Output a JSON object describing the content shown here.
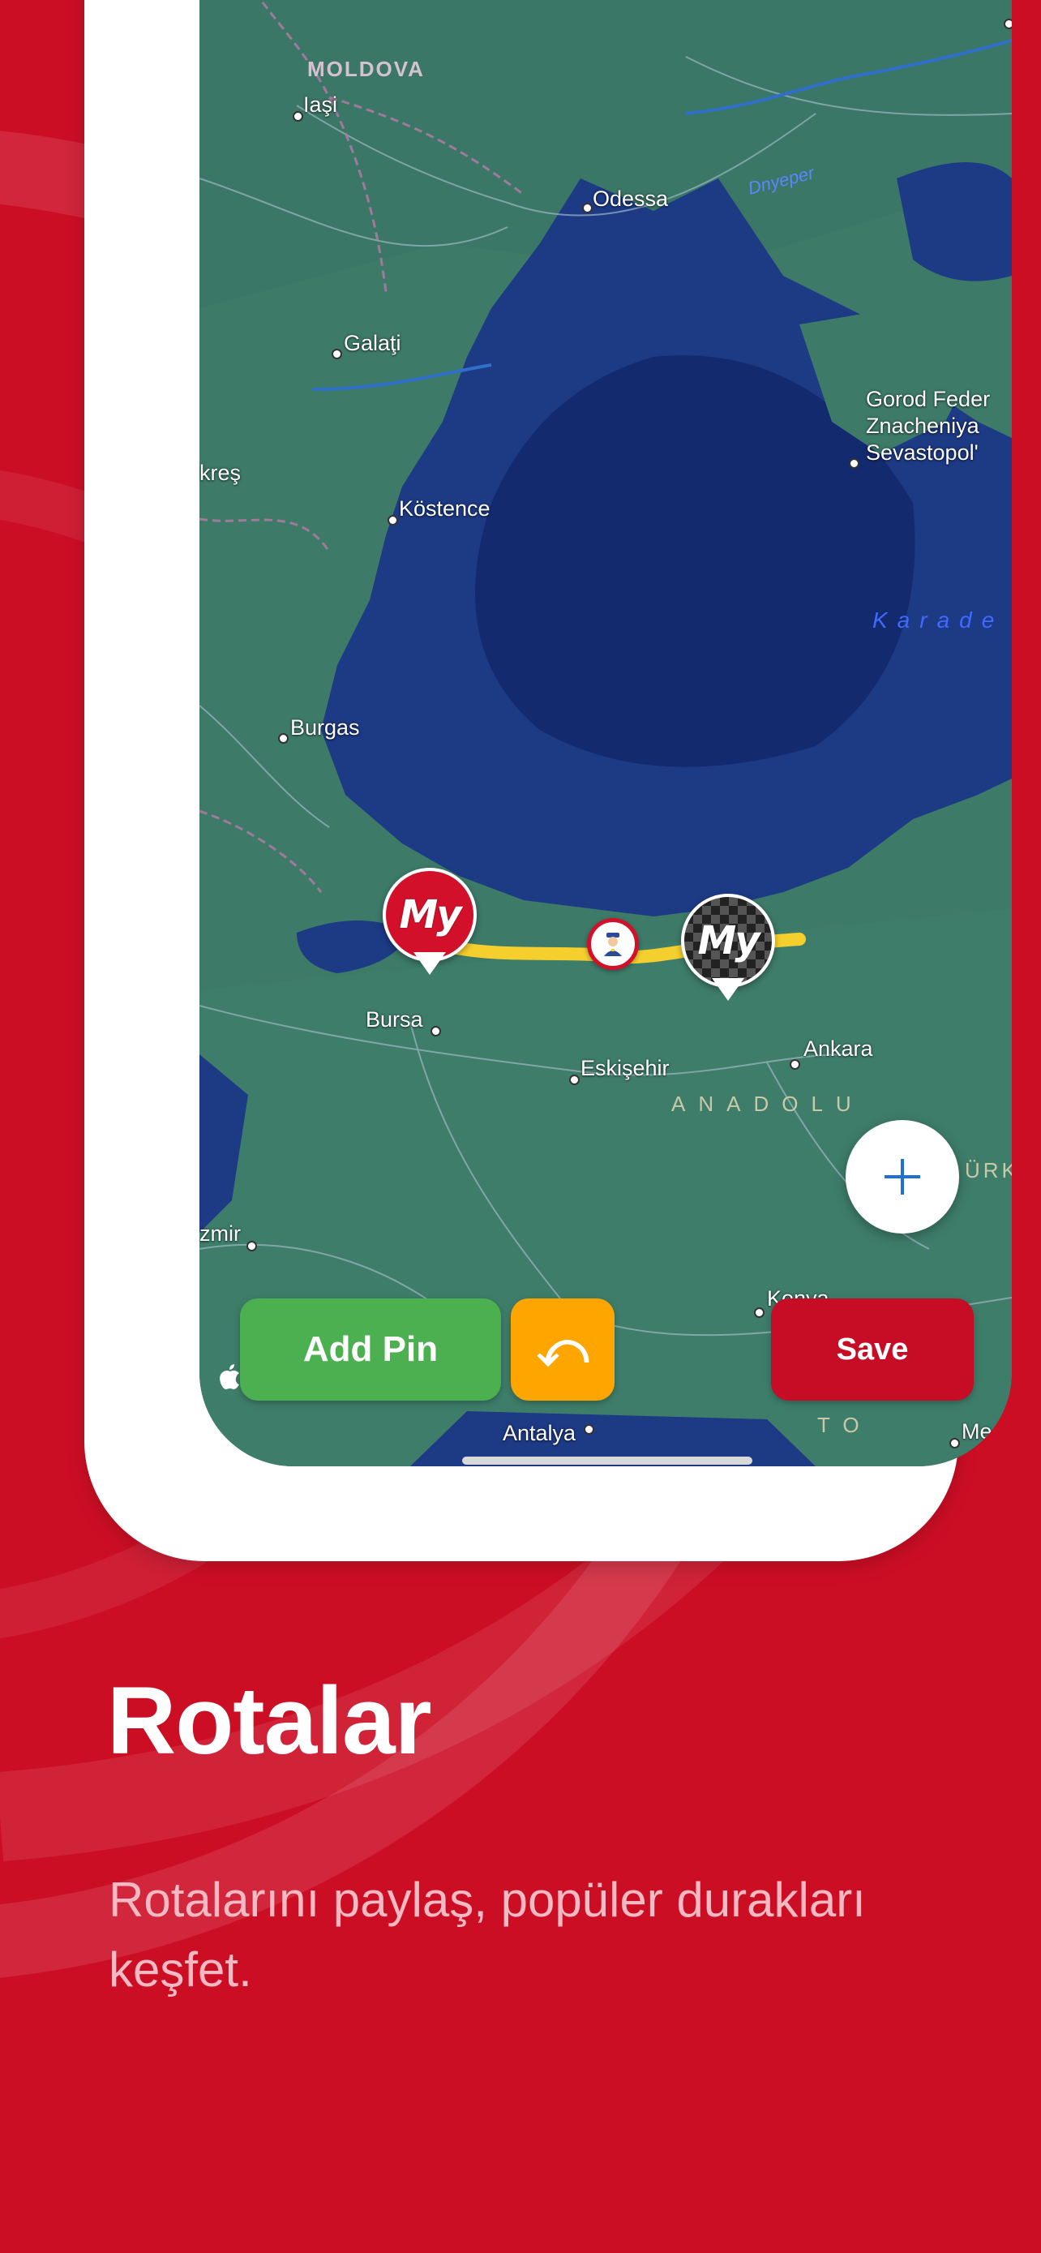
{
  "map": {
    "labels": {
      "moldova": "MOLDOVA",
      "iasi": "Iaşi",
      "odessa": "Odessa",
      "dnieper": "Dnyeper",
      "galati": "Galaţi",
      "sevastopol": "Gorod Feder\nZnacheniya\nSevastopol'",
      "bucharest": "kreş",
      "constanta": "Köstence",
      "black_sea": "Karade",
      "burgas": "Burgas",
      "bursa": "Bursa",
      "eskisehir": "Eskişehir",
      "ankara": "Ankara",
      "anatolia": "ANADOLU",
      "turkey": "ÜRK",
      "izmir": "zmir",
      "konya": "Konya",
      "antalya": "Antalya",
      "toros": "TO",
      "mersin": "Me"
    },
    "pins": {
      "start_logo": "My",
      "finish_logo": "My"
    }
  },
  "controls": {
    "add_pin": "Add Pin",
    "undo_symbol": "⤺",
    "save": "Save"
  },
  "colors": {
    "background": "#cc0e25",
    "route": "#f5cf2d",
    "add_pin": "#4caf50",
    "undo": "#ffa500",
    "save": "#c70d25",
    "fab_plus": "#1f6fd6"
  },
  "headline": {
    "title": "Rotalar",
    "subtitle": "Rotalarını paylaş, popüler durakları keşfet."
  }
}
